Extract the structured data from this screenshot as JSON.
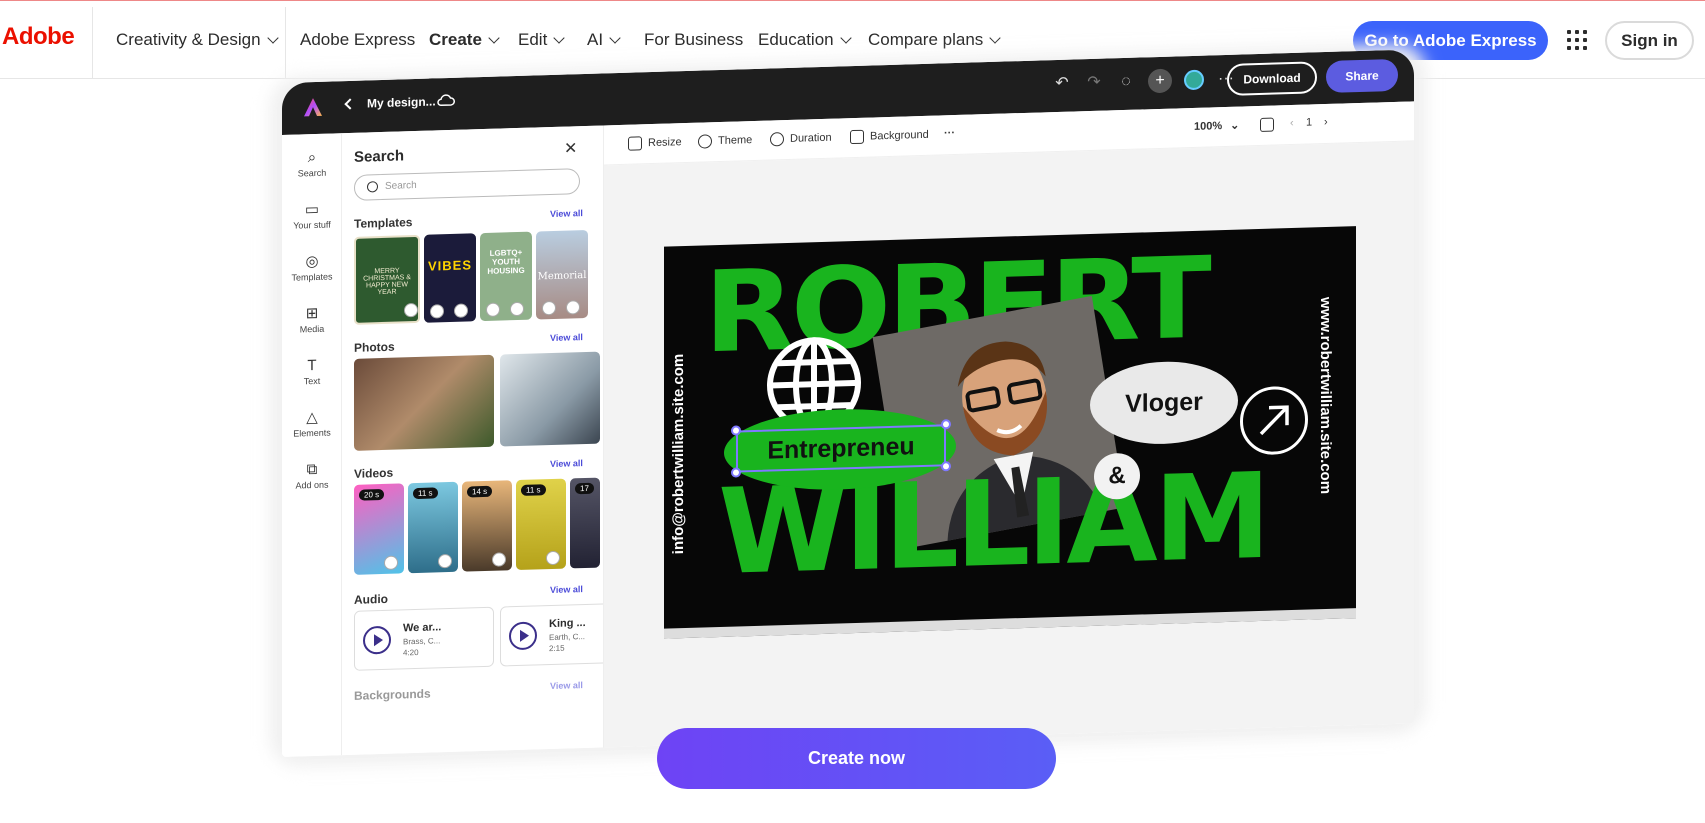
{
  "header": {
    "logo": "Adobe",
    "nav": [
      {
        "label": "Creativity & Design",
        "chevron": true
      },
      {
        "label": "Adobe Express",
        "chevron": false
      },
      {
        "label": "Create",
        "chevron": true,
        "active": true
      },
      {
        "label": "Edit",
        "chevron": true
      },
      {
        "label": "AI",
        "chevron": true
      },
      {
        "label": "For Business",
        "chevron": false
      },
      {
        "label": "Education",
        "chevron": true
      },
      {
        "label": "Compare plans",
        "chevron": true
      }
    ],
    "cta_label": "Go to Adobe Express",
    "apps_icon": "app-grid-icon",
    "signin_label": "Sign in",
    "brand_color": "#eb1000",
    "cta_color": "#3b63fb"
  },
  "editor": {
    "document_title": "My design...",
    "download_label": "Download",
    "share_label": "Share",
    "share_color": "#5c5ce0",
    "top_icons": [
      "undo-icon",
      "redo-icon",
      "lightbulb-icon",
      "invite-icon",
      "avatar",
      "more-icon"
    ],
    "rail": [
      {
        "label": "Search",
        "icon": "search-icon",
        "glyph": "⌕"
      },
      {
        "label": "Your stuff",
        "icon": "folder-icon",
        "glyph": "▭"
      },
      {
        "label": "Templates",
        "icon": "palette-icon",
        "glyph": "◎"
      },
      {
        "label": "Media",
        "icon": "media-icon",
        "glyph": "⊞"
      },
      {
        "label": "Text",
        "icon": "text-icon",
        "glyph": "T"
      },
      {
        "label": "Elements",
        "icon": "shapes-icon",
        "glyph": "△"
      },
      {
        "label": "Add ons",
        "icon": "addons-icon",
        "glyph": "⧉"
      }
    ],
    "panel": {
      "title": "Search",
      "search_placeholder": "Search",
      "sections": {
        "templates": "Templates",
        "photos": "Photos",
        "videos": "Videos",
        "audio": "Audio",
        "backgrounds": "Backgrounds"
      },
      "view_all": "View all",
      "template_thumbs": [
        {
          "text": "MERRY CHRISTMAS & HAPPY NEW YEAR",
          "bg": "#2e5a2f"
        },
        {
          "text": "VIBES",
          "bg": "#1b1b3a"
        },
        {
          "text": "LGBTQ+ YOUTH HOUSING",
          "bg": "#8fb08a"
        },
        {
          "text": "Memorial",
          "bg": "#a78b84"
        }
      ],
      "video_durations": [
        "20 s",
        "11 s",
        "14 s",
        "11 s",
        "17"
      ],
      "audio": [
        {
          "title": "We ar...",
          "genre": "Brass, C...",
          "duration": "4:20"
        },
        {
          "title": "King ...",
          "genre": "Earth, C...",
          "duration": "2:15"
        }
      ]
    },
    "toolbar": {
      "resize": "Resize",
      "theme": "Theme",
      "duration": "Duration",
      "background": "Background",
      "zoom": "100%",
      "page": "1"
    },
    "design": {
      "name_top": "ROBERT",
      "name_bottom": "WILLIAM",
      "role": "Entrepreneu",
      "tag": "Vloger",
      "amp": "&",
      "email": "info@robertwilliam.site.com",
      "website": "www.robertwilliam.site.com",
      "accent": "#19b41e"
    }
  },
  "cta": {
    "label": "Create now"
  }
}
